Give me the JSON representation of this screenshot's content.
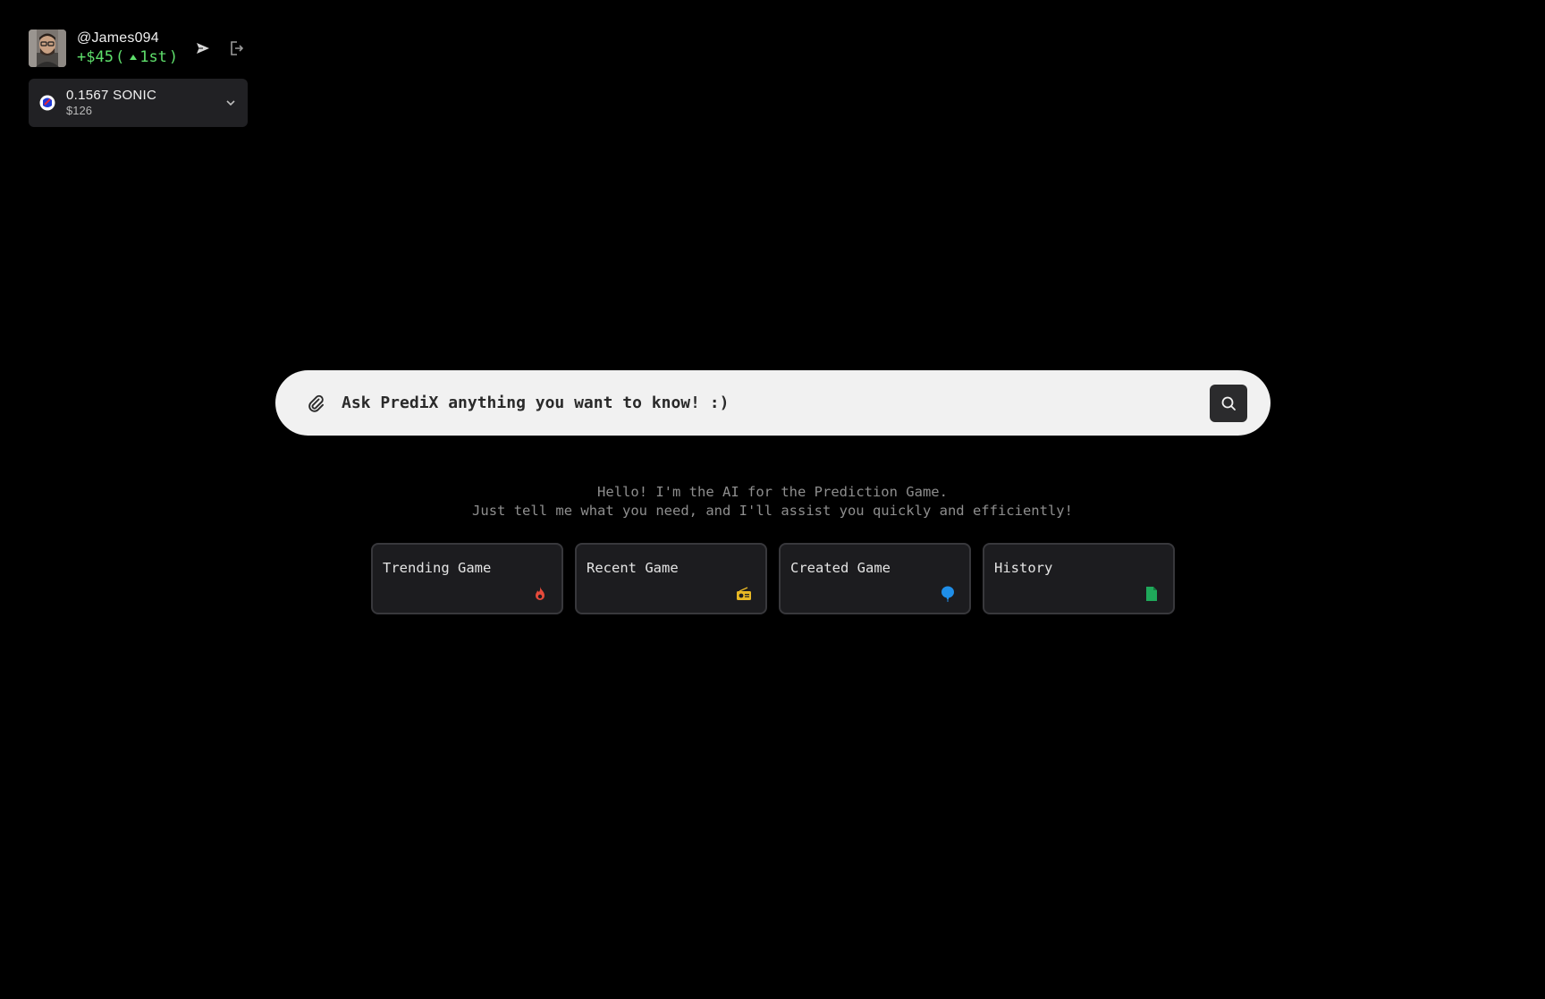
{
  "user": {
    "username": "@James094",
    "pnl_amount": "+$45",
    "paren_open": "(",
    "rank": "1st",
    "paren_close": ")",
    "rank_direction": "up",
    "pnl_color": "#5fe06c"
  },
  "header_actions": {
    "send_icon": "send-icon",
    "logout_icon": "logout-icon"
  },
  "wallet": {
    "amount": "0.1567 SONIC",
    "usd_value": "$126",
    "token_icon": "sonic-token-icon"
  },
  "search": {
    "placeholder": "Ask PrediX anything you want to know! :)",
    "value": ""
  },
  "greeting": {
    "line1": "Hello! I'm the AI for the Prediction Game.",
    "line2": "Just tell me what you need, and I'll assist you quickly and efficiently!"
  },
  "quick_actions": [
    {
      "label": "Trending Game",
      "icon": "fire-icon",
      "color": "#e64a3b"
    },
    {
      "label": "Recent Game",
      "icon": "radio-icon",
      "color": "#e8b825"
    },
    {
      "label": "Created Game",
      "icon": "balloon-icon",
      "color": "#1f8ee8"
    },
    {
      "label": "History",
      "icon": "document-icon",
      "color": "#1fa85a"
    }
  ],
  "colors": {
    "background": "#000000",
    "surface": "#212124",
    "search_bg": "#f1f1f1"
  }
}
